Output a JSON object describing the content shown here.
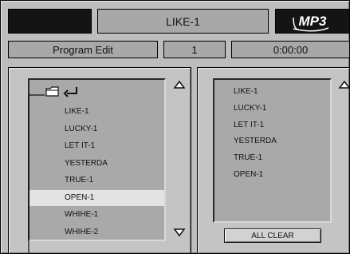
{
  "header": {
    "track_title": "LIKE-1",
    "format_badge": "MP3"
  },
  "status": {
    "mode": "Program Edit",
    "track_number": "1",
    "time": "0:00:00"
  },
  "browser": {
    "items": [
      {
        "label": "LIKE-1"
      },
      {
        "label": "LUCKY-1"
      },
      {
        "label": "LET IT-1"
      },
      {
        "label": "YESTERDA"
      },
      {
        "label": "TRUE-1"
      },
      {
        "label": "OPEN-1",
        "selected": true
      },
      {
        "label": "WHIHE-1"
      },
      {
        "label": "WHIHE-2"
      }
    ]
  },
  "program": {
    "items": [
      {
        "label": "LIKE-1"
      },
      {
        "label": "LUCKY-1"
      },
      {
        "label": "LET IT-1"
      },
      {
        "label": "YESTERDA"
      },
      {
        "label": "TRUE-1"
      },
      {
        "label": "OPEN-1"
      }
    ],
    "all_clear_label": "ALL CLEAR"
  },
  "icons": [
    "folder-icon",
    "return-arrow-icon",
    "scroll-up-icon",
    "scroll-down-icon",
    "callout-leader-line"
  ]
}
